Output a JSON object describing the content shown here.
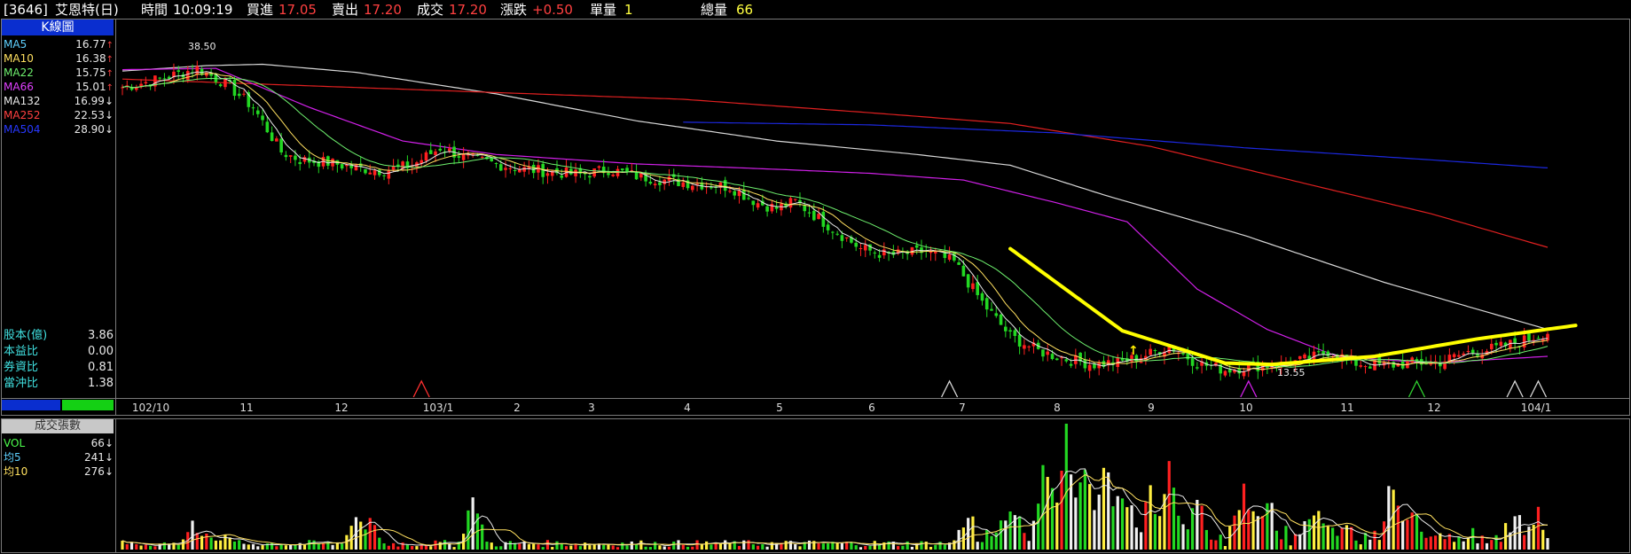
{
  "header": {
    "code": "[3646]",
    "name": "艾恩特(日)",
    "time_label": "時間",
    "time": "10:09:19",
    "bid_label": "買進",
    "bid": "17.05",
    "ask_label": "賣出",
    "ask": "17.20",
    "trade_label": "成交",
    "trade": "17.20",
    "change_label": "漲跌",
    "change": "+0.50",
    "lot_label": "單量",
    "lot": "1",
    "total_label": "總量",
    "total": "66"
  },
  "kline_panel": {
    "title": "K線圖",
    "ma": [
      {
        "label": "MA5",
        "value": "16.77",
        "arrow": "↑",
        "color": "#5fd0ff"
      },
      {
        "label": "MA10",
        "value": "16.38",
        "arrow": "↑",
        "color": "#ffe060"
      },
      {
        "label": "MA22",
        "value": "15.75",
        "arrow": "↑",
        "color": "#6ef06e"
      },
      {
        "label": "MA66",
        "value": "15.01",
        "arrow": "↑",
        "color": "#e040ff"
      },
      {
        "label": "MA132",
        "value": "16.99",
        "arrow": "↓",
        "color": "#e8e8e8"
      },
      {
        "label": "MA252",
        "value": "22.53",
        "arrow": "↓",
        "color": "#ff4040"
      },
      {
        "label": "MA504",
        "value": "28.90",
        "arrow": "↓",
        "color": "#2030ff"
      }
    ],
    "stats": [
      {
        "label": "股本(億)",
        "value": "3.86"
      },
      {
        "label": "本益比",
        "value": "0.00"
      },
      {
        "label": "券資比",
        "value": "0.81"
      },
      {
        "label": "當沖比",
        "value": "1.38"
      }
    ]
  },
  "vol_panel": {
    "title": "成交張數",
    "rows": [
      {
        "label": "VOL",
        "value": "66",
        "arrow": "↓",
        "color": "#4dff4d"
      },
      {
        "label": "均5",
        "value": "241",
        "arrow": "↓",
        "color": "#5fd0ff"
      },
      {
        "label": "均10",
        "value": "276",
        "arrow": "↓",
        "color": "#ffe060"
      }
    ]
  },
  "chart_data": {
    "type": "candlestick",
    "x_ticks": [
      "102/10",
      "11",
      "12",
      "103/1",
      "2",
      "3",
      "4",
      "5",
      "6",
      "7",
      "8",
      "9",
      "10",
      "11",
      "12",
      "104/1"
    ],
    "annotations": {
      "high_label": "38.50",
      "low_label": "13.55"
    },
    "ylim": [
      12.5,
      39.5
    ],
    "close_path": [
      [
        0,
        35.0
      ],
      [
        8,
        35.6
      ],
      [
        16,
        36.4
      ],
      [
        22,
        35.3
      ],
      [
        28,
        33.5
      ],
      [
        34,
        30.2
      ],
      [
        38,
        29.6
      ],
      [
        44,
        29.4
      ],
      [
        50,
        29.0
      ],
      [
        56,
        28.8
      ],
      [
        62,
        29.2
      ],
      [
        68,
        30.5
      ],
      [
        74,
        29.7
      ],
      [
        80,
        29.3
      ],
      [
        86,
        28.9
      ],
      [
        92,
        28.7
      ],
      [
        98,
        28.5
      ],
      [
        104,
        28.9
      ],
      [
        110,
        28.4
      ],
      [
        118,
        28.0
      ],
      [
        124,
        27.8
      ],
      [
        130,
        27.6
      ],
      [
        136,
        26.4
      ],
      [
        140,
        26.0
      ],
      [
        144,
        26.5
      ],
      [
        150,
        25.0
      ],
      [
        158,
        23.0
      ],
      [
        164,
        22.5
      ],
      [
        172,
        22.8
      ],
      [
        178,
        22.0
      ],
      [
        184,
        19.0
      ],
      [
        190,
        16.5
      ],
      [
        196,
        15.4
      ],
      [
        202,
        14.8
      ],
      [
        208,
        14.4
      ],
      [
        214,
        14.6
      ],
      [
        220,
        15.2
      ],
      [
        224,
        15.8
      ],
      [
        230,
        14.5
      ],
      [
        236,
        14.0
      ],
      [
        242,
        14.3
      ],
      [
        248,
        14.4
      ],
      [
        254,
        14.8
      ],
      [
        258,
        15.4
      ],
      [
        264,
        14.5
      ],
      [
        270,
        14.3
      ],
      [
        276,
        14.5
      ],
      [
        282,
        14.6
      ],
      [
        288,
        15.3
      ],
      [
        294,
        15.6
      ],
      [
        300,
        16.2
      ],
      [
        305,
        16.8
      ]
    ],
    "n_bars": 306,
    "ma_lines": [
      {
        "name": "MA132",
        "color": "#d8d8d8",
        "pts": [
          [
            0,
            36.2
          ],
          [
            18,
            36.6
          ],
          [
            30,
            36.7
          ],
          [
            50,
            36.1
          ],
          [
            80,
            34.5
          ],
          [
            110,
            32.5
          ],
          [
            140,
            31.0
          ],
          [
            170,
            30.0
          ],
          [
            190,
            29.2
          ],
          [
            210,
            27.0
          ],
          [
            240,
            24.0
          ],
          [
            270,
            20.5
          ],
          [
            305,
            17.0
          ]
        ]
      },
      {
        "name": "MA252",
        "color": "#e02020",
        "pts": [
          [
            0,
            35.6
          ],
          [
            40,
            35.1
          ],
          [
            80,
            34.6
          ],
          [
            120,
            34.1
          ],
          [
            160,
            33.1
          ],
          [
            190,
            32.3
          ],
          [
            220,
            30.6
          ],
          [
            250,
            28.1
          ],
          [
            280,
            25.6
          ],
          [
            305,
            23.1
          ]
        ]
      },
      {
        "name": "MA504",
        "color": "#1c28e0",
        "pts": [
          [
            120,
            32.4
          ],
          [
            160,
            32.2
          ],
          [
            200,
            31.6
          ],
          [
            240,
            30.5
          ],
          [
            280,
            29.6
          ],
          [
            305,
            29.0
          ]
        ]
      },
      {
        "name": "MA66",
        "color": "#d020e8",
        "pts": [
          [
            0,
            36.3
          ],
          [
            20,
            36.4
          ],
          [
            40,
            33.5
          ],
          [
            60,
            31.0
          ],
          [
            80,
            30.0
          ],
          [
            110,
            29.3
          ],
          [
            140,
            28.9
          ],
          [
            160,
            28.6
          ],
          [
            180,
            28.1
          ],
          [
            200,
            26.4
          ],
          [
            215,
            25.0
          ],
          [
            230,
            20.0
          ],
          [
            245,
            17.0
          ],
          [
            260,
            15.0
          ],
          [
            280,
            14.5
          ],
          [
            305,
            15.0
          ]
        ]
      }
    ],
    "trend_line": {
      "color": "#ffff00",
      "pts": [
        [
          190,
          23.0
        ],
        [
          214,
          16.9
        ],
        [
          236,
          14.5
        ],
        [
          246,
          14.4
        ],
        [
          268,
          15.0
        ],
        [
          290,
          16.3
        ],
        [
          311,
          17.3
        ]
      ]
    },
    "markers": [
      {
        "x": 64,
        "color": "#ff3030"
      },
      {
        "x": 177,
        "color": "#d8d8d8"
      },
      {
        "x": 241,
        "color": "#d020e8"
      },
      {
        "x": 277,
        "color": "#30d030"
      },
      {
        "x": 298,
        "color": "#d8d8d8"
      },
      {
        "x": 303,
        "color": "#d8d8d8"
      }
    ],
    "volume_spikes": [
      [
        15,
        260
      ],
      [
        18,
        210
      ],
      [
        22,
        160
      ],
      [
        50,
        340
      ],
      [
        53,
        300
      ],
      [
        75,
        490
      ],
      [
        180,
        250
      ],
      [
        190,
        340
      ],
      [
        198,
        880
      ],
      [
        202,
        1000
      ],
      [
        206,
        750
      ],
      [
        210,
        680
      ],
      [
        214,
        510
      ],
      [
        220,
        520
      ],
      [
        224,
        620
      ],
      [
        230,
        330
      ],
      [
        240,
        520
      ],
      [
        245,
        420
      ],
      [
        255,
        350
      ],
      [
        262,
        280
      ],
      [
        272,
        640
      ],
      [
        276,
        360
      ],
      [
        298,
        300
      ],
      [
        303,
        280
      ]
    ]
  }
}
